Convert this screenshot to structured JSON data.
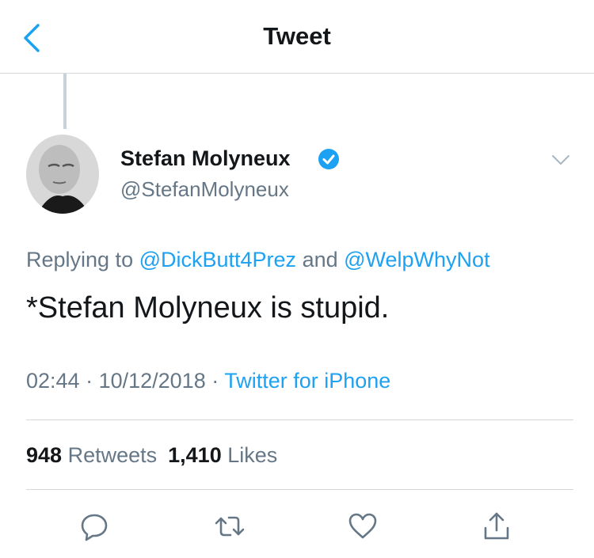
{
  "header": {
    "title": "Tweet"
  },
  "tweet": {
    "author": {
      "name": "Stefan Molyneux",
      "handle": "@StefanMolyneux",
      "verified": true
    },
    "replying": {
      "prefix": "Replying to ",
      "user1": "@DickButt4Prez",
      "conj": " and ",
      "user2": "@WelpWhyNot"
    },
    "text": "*Stefan Molyneux is stupid.",
    "time": "02:44",
    "sep1": " · ",
    "date": "10/12/2018",
    "sep2": " · ",
    "source": "Twitter for iPhone",
    "retweets_count": "948",
    "retweets_label": "Retweets",
    "likes_count": "1,410",
    "likes_label": "Likes"
  },
  "colors": {
    "accent": "#1da1f2",
    "secondary_text": "#657786",
    "divider": "#d6d9dc",
    "icon": "#657786"
  },
  "icons": [
    "back-chevron-icon",
    "verified-badge-icon",
    "chevron-down-icon",
    "reply-icon",
    "retweet-icon",
    "like-icon",
    "share-icon"
  ]
}
